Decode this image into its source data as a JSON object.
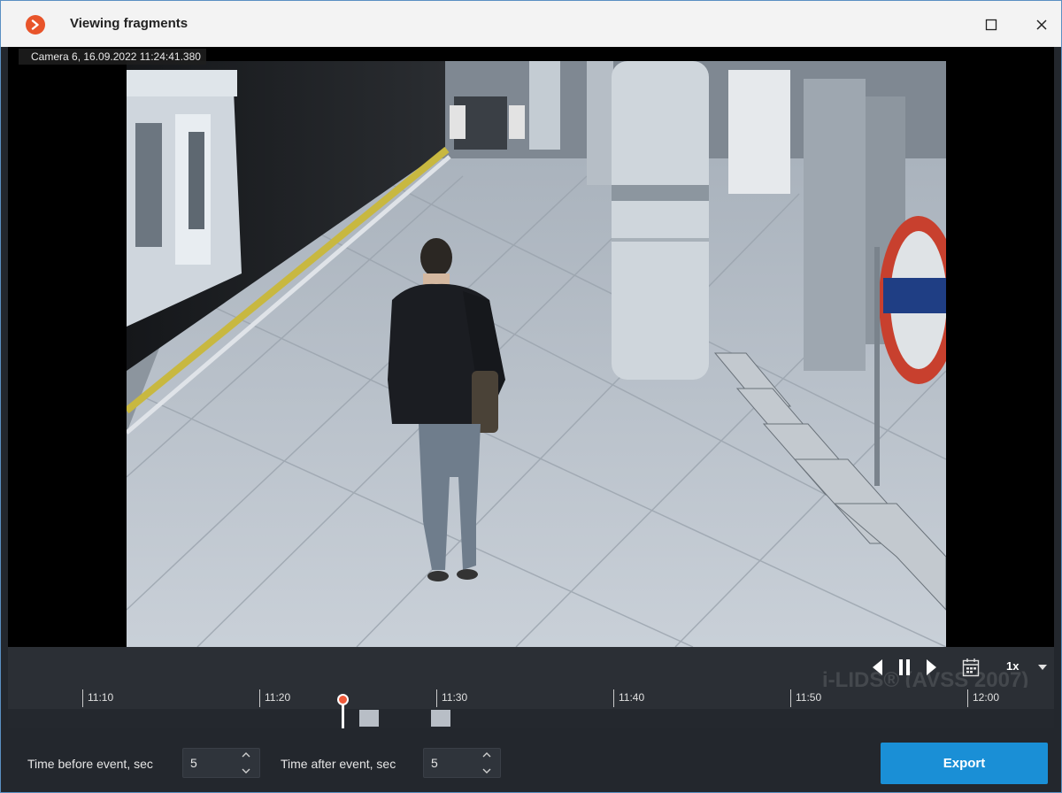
{
  "window": {
    "title": "Viewing fragments",
    "accent_color": "#e8542a"
  },
  "video": {
    "camera_label": "Camera 6, 16.09.2022 11:24:41.380",
    "watermark": "i-LIDS® (AVSS 2007)"
  },
  "controls": {
    "speed": "1x",
    "icons": [
      "prev-frame-icon",
      "pause-icon",
      "play-icon",
      "calendar-icon",
      "chevron-down-icon"
    ]
  },
  "timeline": {
    "ticks": [
      "11:10",
      "11:20",
      "11:30",
      "11:40",
      "11:50",
      "12:00"
    ],
    "cursor_time": "11:24:41",
    "cursor_color": "#f05a3a"
  },
  "bottom": {
    "before_label": "Time before event, sec",
    "before_value": "5",
    "after_label": "Time after event, sec",
    "after_value": "5",
    "export_label": "Export",
    "export_color": "#1a8fd6"
  }
}
